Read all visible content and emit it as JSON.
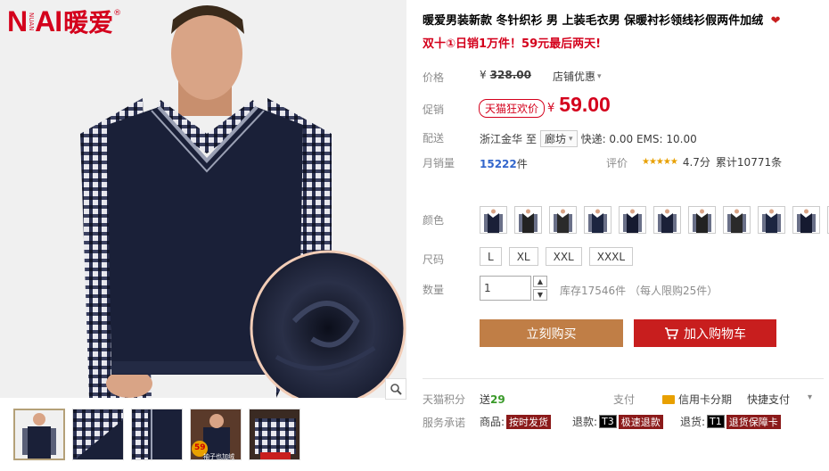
{
  "brand": {
    "logo_latin": "NAI",
    "logo_small": "NUAN",
    "logo_cn": "暖爱",
    "registered": "®"
  },
  "product": {
    "title": "暖爱男装新款 冬针织衫 男 上装毛衣男 保暖衬衫领线衫假两件加绒",
    "promo_line": "双十①日销1万件！59元最后两天!"
  },
  "price": {
    "label": "价格",
    "currency": "¥",
    "old_value": "328.00",
    "shop_discount": "店铺优惠"
  },
  "promo": {
    "label": "促销",
    "badge": "天猫狂欢价",
    "currency": "¥",
    "value": "59.00"
  },
  "delivery": {
    "label": "配送",
    "from": "浙江金华",
    "to_word": "至",
    "destination": "廊坊",
    "fee": "快递: 0.00 EMS: 10.00"
  },
  "sales": {
    "label": "月销量",
    "count": "15222",
    "unit": "件",
    "rating_label": "评价",
    "rating_score": "4.7分",
    "reviews": "累计10771条"
  },
  "color": {
    "label": "颜色",
    "swatch_count": 11
  },
  "size": {
    "label": "尺码",
    "options": [
      "L",
      "XL",
      "XXL",
      "XXXL"
    ]
  },
  "quantity": {
    "label": "数量",
    "value": "1",
    "stock": "库存17546件 （每人限购25件）"
  },
  "actions": {
    "buy_now": "立刻购买",
    "add_to_cart": "加入购物车"
  },
  "points": {
    "label": "天猫积分",
    "prefix": "送",
    "value": "29"
  },
  "payment": {
    "label": "支付",
    "credit": "信用卡分期",
    "quick": "快捷支付"
  },
  "service": {
    "label": "服务承诺",
    "items": [
      {
        "prefix": "商品:",
        "tag": "按时发货"
      },
      {
        "prefix": "退款:",
        "tag_code": "T3",
        "tag": "极速退款"
      },
      {
        "prefix": "退货:",
        "tag_code": "T1",
        "tag": "退货保障卡"
      }
    ]
  },
  "thumbnails": {
    "badge_text": "59",
    "sleeve_text": "袖子也加绒"
  },
  "colors": {
    "accent_red": "#d4001c",
    "buy_button": "#c07e46",
    "cart_button": "#c81e1e",
    "sweater_navy": "#1a2038"
  }
}
